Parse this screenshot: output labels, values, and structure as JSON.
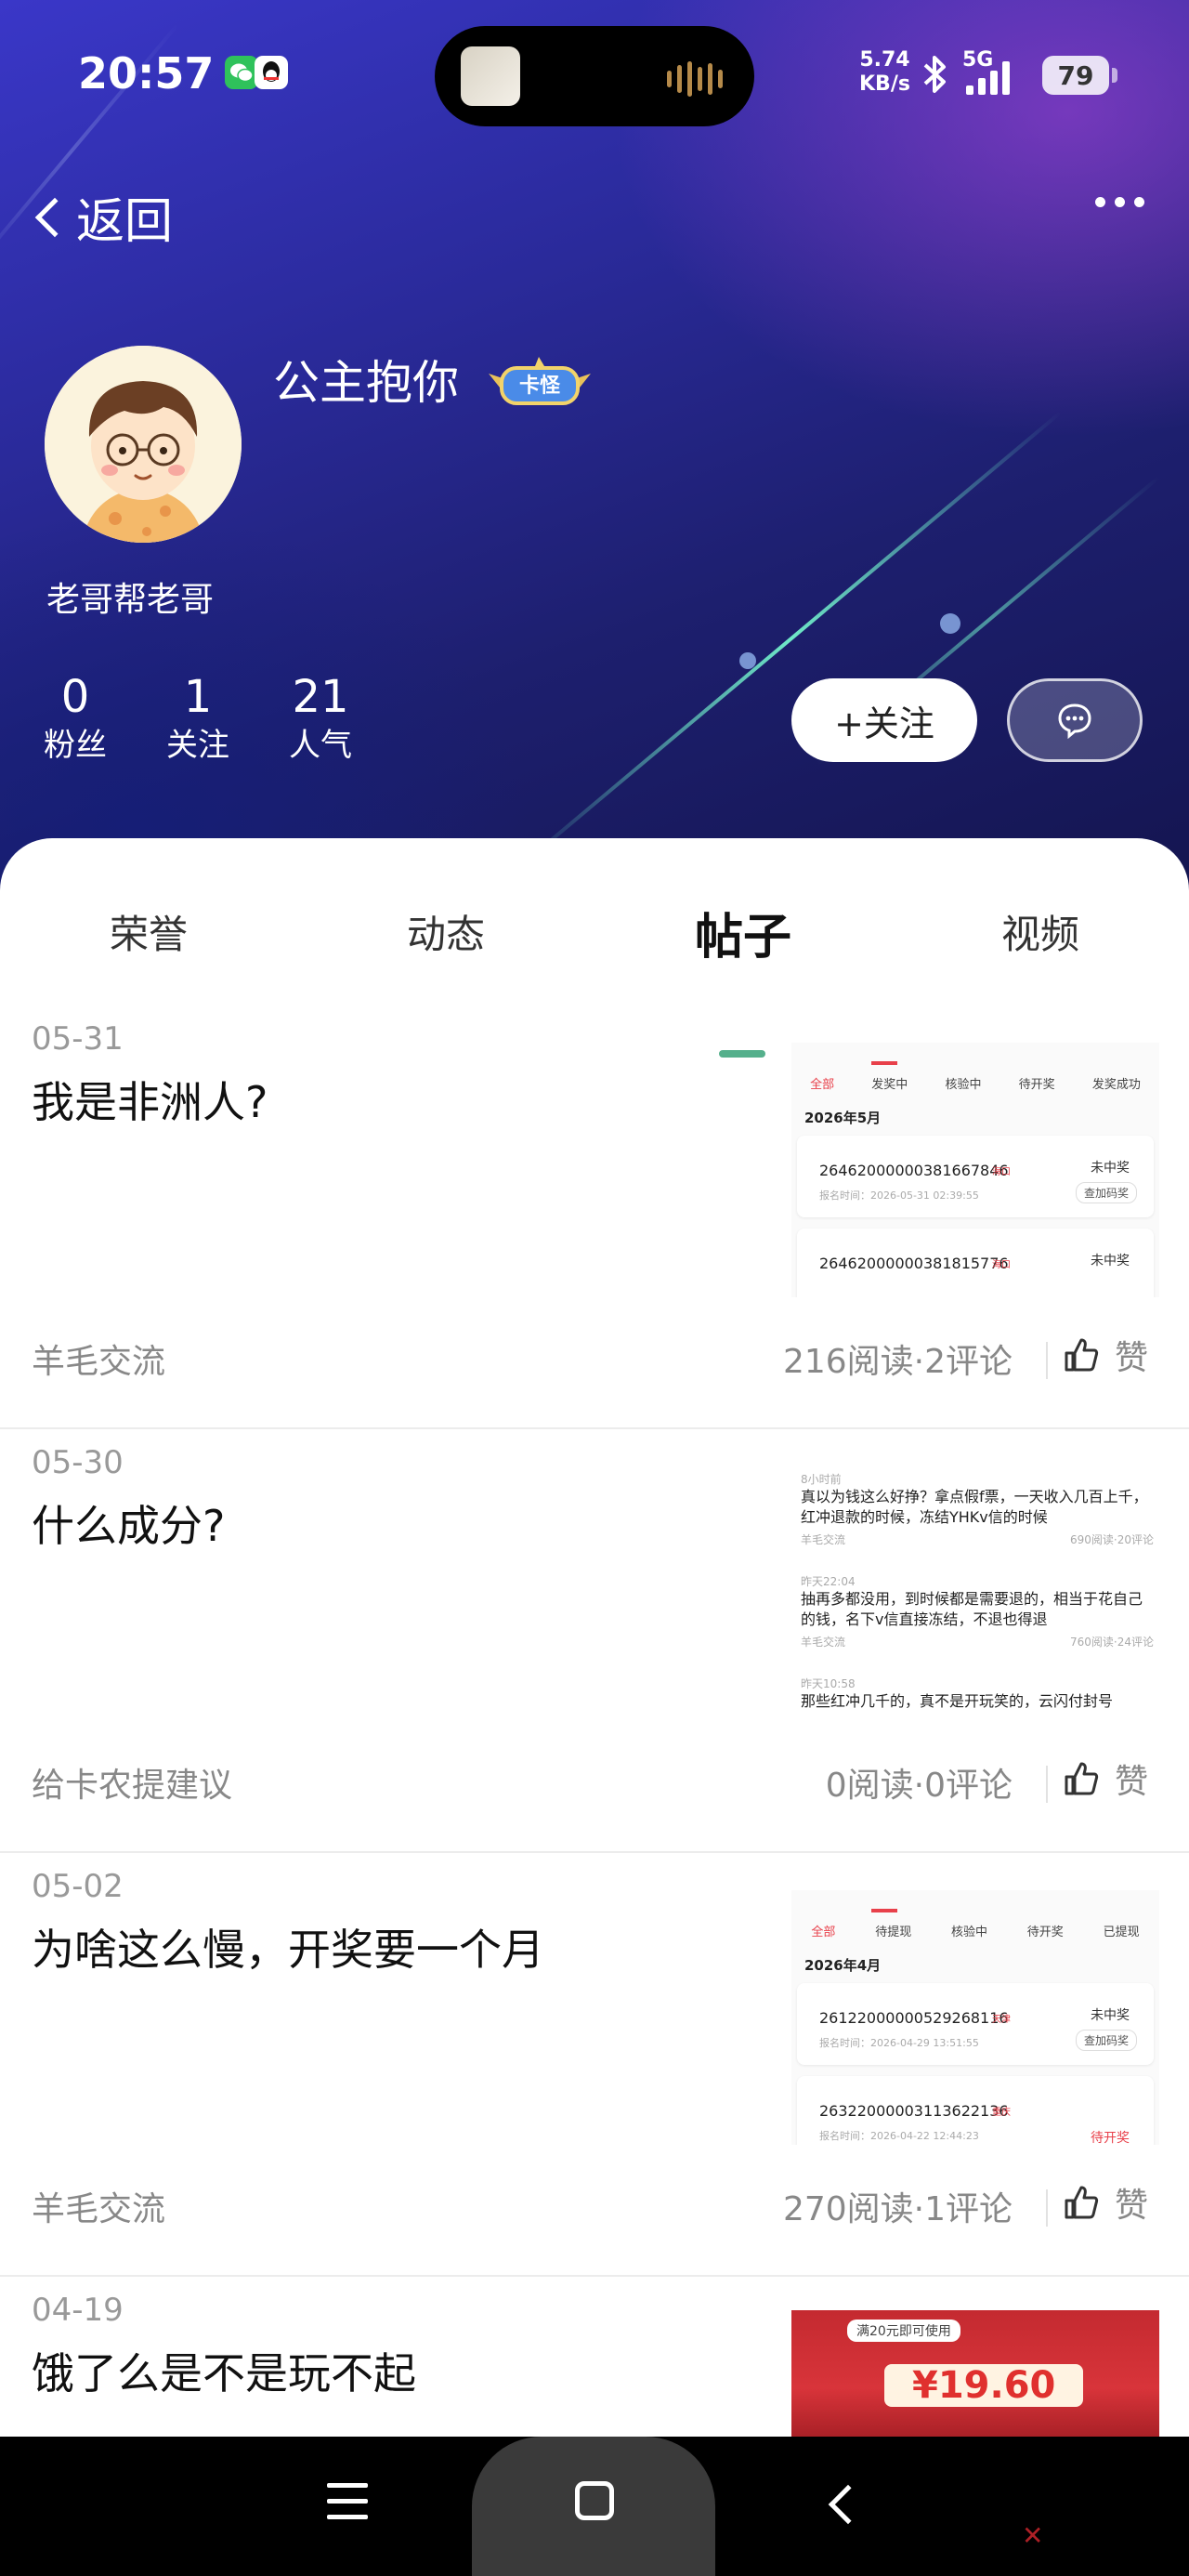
{
  "status_bar": {
    "time": "20:57",
    "net_speed_value": "5.74",
    "net_speed_unit": "KB/s",
    "network": "5G",
    "battery": "79"
  },
  "nav": {
    "back_label": "返回"
  },
  "profile": {
    "nickname": "公主抱你",
    "badge": "卡怪",
    "signature": "老哥帮老哥",
    "stats": [
      {
        "value": "0",
        "label": "粉丝"
      },
      {
        "value": "1",
        "label": "关注"
      },
      {
        "value": "21",
        "label": "人气"
      }
    ],
    "follow_label": "+关注"
  },
  "tabs": [
    {
      "label": "荣誉",
      "active": false
    },
    {
      "label": "动态",
      "active": false
    },
    {
      "label": "帖子",
      "active": true
    },
    {
      "label": "视频",
      "active": false
    }
  ],
  "posts": [
    {
      "date": "05-31",
      "title": "我是非洲人?",
      "category": "羊毛交流",
      "meta": "216阅读·2评论",
      "like_label": "赞",
      "thumb": {
        "tabs": [
          "全部",
          "发奖中",
          "核验中",
          "待开奖",
          "发奖成功"
        ],
        "month": "2026年5月",
        "cards": [
          {
            "number": "26462000000381667846",
            "loc": "海口",
            "time": "报名时间：2026-05-31 02:39:55",
            "result": "未中奖",
            "button": "查加码奖"
          },
          {
            "number": "26462000000381815776",
            "loc": "海口",
            "time": "",
            "result": "未中奖",
            "button": ""
          }
        ]
      }
    },
    {
      "date": "05-30",
      "title": "什么成分?",
      "category": "给卡农提建议",
      "meta": "0阅读·0评论",
      "like_label": "赞",
      "thumb": {
        "feed": [
          {
            "time": "8小时前",
            "text": "真以为钱这么好挣？拿点假f票，一天收入几百上千，红冲退款的时候，冻结YHKv信的时候",
            "cat": "羊毛交流",
            "stats": "690阅读·20评论"
          },
          {
            "time": "昨天22:04",
            "text": "抽再多都没用，到时候都是需要退的，相当于花自己的钱，名下v信直接冻结，不退也得退",
            "cat": "羊毛交流",
            "stats": "760阅读·24评论"
          },
          {
            "time": "昨天10:58",
            "text": "那些红冲几千的，真不是开玩笑的，云闪付封号",
            "cat": "",
            "stats": ""
          }
        ]
      }
    },
    {
      "date": "05-02",
      "title": "为啥这么慢，开奖要一个月",
      "category": "羊毛交流",
      "meta": "270阅读·1评论",
      "like_label": "赞",
      "thumb": {
        "tabs": [
          "全部",
          "待提现",
          "核验中",
          "待开奖",
          "已提现"
        ],
        "month": "2026年4月",
        "cards": [
          {
            "number": "26122000000529268116",
            "loc": "天津",
            "time": "报名时间：2026-04-29 13:51:55",
            "result": "未中奖",
            "button": "查加码奖"
          },
          {
            "number": "26322000003113622136",
            "loc": "重庆",
            "time": "报名时间：2026-04-22 12:44:23",
            "result": "待开奖",
            "button": ""
          }
        ]
      }
    },
    {
      "date": "04-19",
      "title": "饿了么是不是玩不起",
      "thumb_tag": "满20元即可使用",
      "thumb_price": "¥19.60"
    }
  ]
}
